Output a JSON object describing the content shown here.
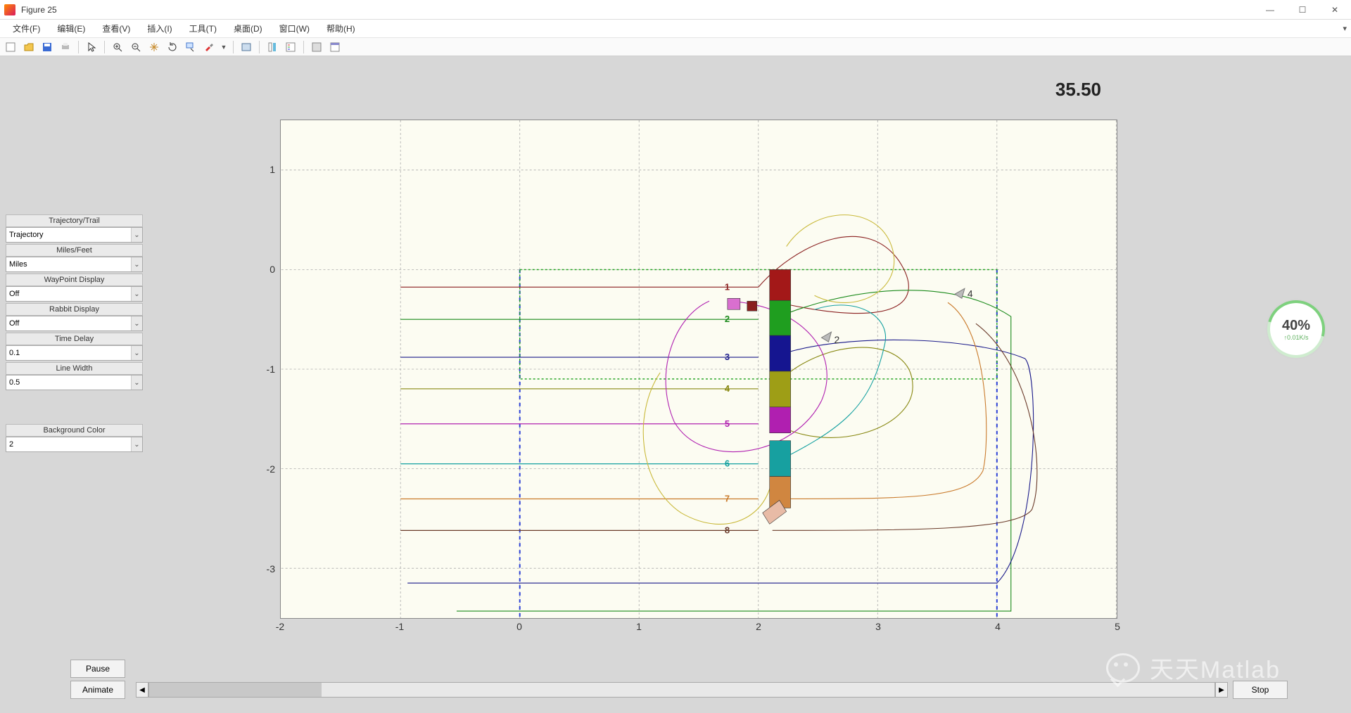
{
  "window": {
    "title": "Figure 25"
  },
  "menu": {
    "file": "文件(F)",
    "edit": "编辑(E)",
    "view": "查看(V)",
    "insert": "插入(I)",
    "tools": "工具(T)",
    "desktop": "桌面(D)",
    "window": "窗口(W)",
    "help": "帮助(H)"
  },
  "panel": {
    "trajectory_label": "Trajectory/Trail",
    "trajectory_value": "Trajectory",
    "milesfeet_label": "Miles/Feet",
    "milesfeet_value": "Miles",
    "waypoint_label": "WayPoint Display",
    "waypoint_value": "Off",
    "rabbit_label": "Rabbit Display",
    "rabbit_value": "Off",
    "timedelay_label": "Time Delay",
    "timedelay_value": "0.1",
    "linewidth_label": "Line Width",
    "linewidth_value": "0.5",
    "bgcolor_label": "Background Color",
    "bgcolor_value": "2"
  },
  "buttons": {
    "pause": "Pause",
    "animate": "Animate",
    "stop": "Stop"
  },
  "plot": {
    "time": "35.50",
    "xticks": [
      "-2",
      "-1",
      "0",
      "1",
      "2",
      "3",
      "4",
      "5"
    ],
    "yticks": [
      "1",
      "0",
      "-1",
      "-2",
      "-3"
    ],
    "lane_labels": [
      "1",
      "2",
      "3",
      "4",
      "5",
      "6",
      "7",
      "8"
    ],
    "marker_labels": {
      "m2": "2",
      "m4": "4"
    }
  },
  "widget": {
    "main": "40%",
    "sub": "↑0.01K/s"
  },
  "watermark": "天天Matlab",
  "chart_data": {
    "type": "line",
    "xlim": [
      -2,
      5
    ],
    "ylim": [
      -3.5,
      1.5
    ],
    "time": 35.5,
    "runway_box": {
      "x0": 0,
      "x1": 4,
      "y_top": 0,
      "y_bottom": -3.5
    },
    "green_dotted_box_y": [
      0,
      -1.1
    ],
    "lanes": [
      {
        "id": 1,
        "y": -0.18,
        "color": "#8a1f1f"
      },
      {
        "id": 2,
        "y": -0.5,
        "color": "#1a8a1a"
      },
      {
        "id": 3,
        "y": -0.88,
        "color": "#1a1a8a"
      },
      {
        "id": 4,
        "y": -1.2,
        "color": "#878710"
      },
      {
        "id": 5,
        "y": -1.55,
        "color": "#b020b0"
      },
      {
        "id": 6,
        "y": -1.95,
        "color": "#13a0a0"
      },
      {
        "id": 7,
        "y": -2.3,
        "color": "#c97a2b"
      },
      {
        "id": 8,
        "y": -2.62,
        "color": "#6a3a2a"
      }
    ],
    "stack_blocks": [
      {
        "y_top": 0.0,
        "y_bot": -0.31,
        "color": "#a31818"
      },
      {
        "y_top": -0.31,
        "y_bot": -0.66,
        "color": "#1f9e1f"
      },
      {
        "y_top": -0.66,
        "y_bot": -1.02,
        "color": "#151590"
      },
      {
        "y_top": -1.02,
        "y_bot": -1.38,
        "color": "#9e9e16"
      },
      {
        "y_top": -1.38,
        "y_bot": -1.64,
        "color": "#b01fb0"
      },
      {
        "y_top": -1.72,
        "y_bot": -2.08,
        "color": "#17a0a0"
      },
      {
        "y_top": -2.08,
        "y_bot": -2.4,
        "color": "#d08640"
      }
    ],
    "stack_x": 2.08
  }
}
